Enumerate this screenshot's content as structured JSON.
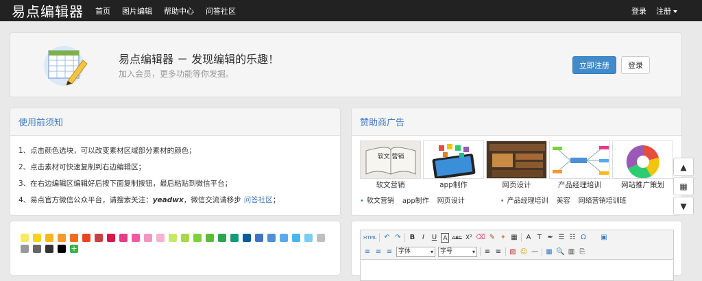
{
  "nav": {
    "brand": "易点编辑器",
    "items": [
      "首页",
      "图片编辑",
      "帮助中心",
      "问答社区"
    ],
    "login": "登录",
    "register": "注册"
  },
  "hero": {
    "title": "易点编辑器 － 发现编辑的乐趣！",
    "subtitle": "加入会员，更多功能等你发掘。",
    "register_btn": "立即注册",
    "login_btn": "登录"
  },
  "notice": {
    "heading": "使用前须知",
    "items": [
      "1、点击颜色选块，可以改变素材区域部分素材的颜色；",
      "2、点击素材可快速复制到右边编辑区；",
      "3、在右边编辑区编辑好后按下面复制按钮，最后粘贴到微信平台；"
    ],
    "item4_prefix": "4、易点官方微信公众平台，请搜索关注：",
    "item4_account": "yeadwx",
    "item4_mid": "，微信交流请移步",
    "item4_link": "问答社区",
    "item4_suffix": "；"
  },
  "ads": {
    "heading": "赞助商广告",
    "thumb_text": "软文 营销",
    "captions": [
      "软文营销",
      "app制作",
      "网页设计",
      "产品经理培训",
      "网站推广策划"
    ],
    "links": [
      "软文营销",
      "app制作",
      "网页设计",
      "产品经理培训",
      "美容",
      "网络营销培训班"
    ]
  },
  "colors": [
    "#f7ea60",
    "#fbd31a",
    "#f6b81c",
    "#f39a2a",
    "#f26b1d",
    "#e8481f",
    "#c94040",
    "#d9164a",
    "#e73a87",
    "#ef5aa3",
    "#f196c3",
    "#f6b3d0",
    "#c5e86a",
    "#a5d84b",
    "#7dd23a",
    "#5fba3c",
    "#2ea452",
    "#169a76",
    "#0a5a9e",
    "#3f74c8",
    "#4f8fd8",
    "#5aa9ee",
    "#45b6f0",
    "#7ccdf2",
    "#bfbfbf",
    "#999999",
    "#666666",
    "#333333",
    "#000000"
  ],
  "colors_add": "+",
  "editor": {
    "row1": [
      "HTML",
      "↶",
      "↷",
      "B",
      "I",
      "U",
      "A",
      "ABC",
      "X²",
      "⌫",
      "✎",
      "✦",
      "▦",
      "A",
      "T",
      "✒",
      "☰",
      "☷",
      "Ω",
      "▣"
    ],
    "font_label": "字体",
    "size_label": "字号",
    "row2": [
      "≡",
      "≡",
      "≡",
      "≡",
      "≡",
      "▨",
      "☺",
      "—",
      "▦",
      "🔍",
      "▥",
      "⎘"
    ]
  },
  "side": {
    "up": "▲",
    "qr": "▦",
    "down": "▼"
  }
}
